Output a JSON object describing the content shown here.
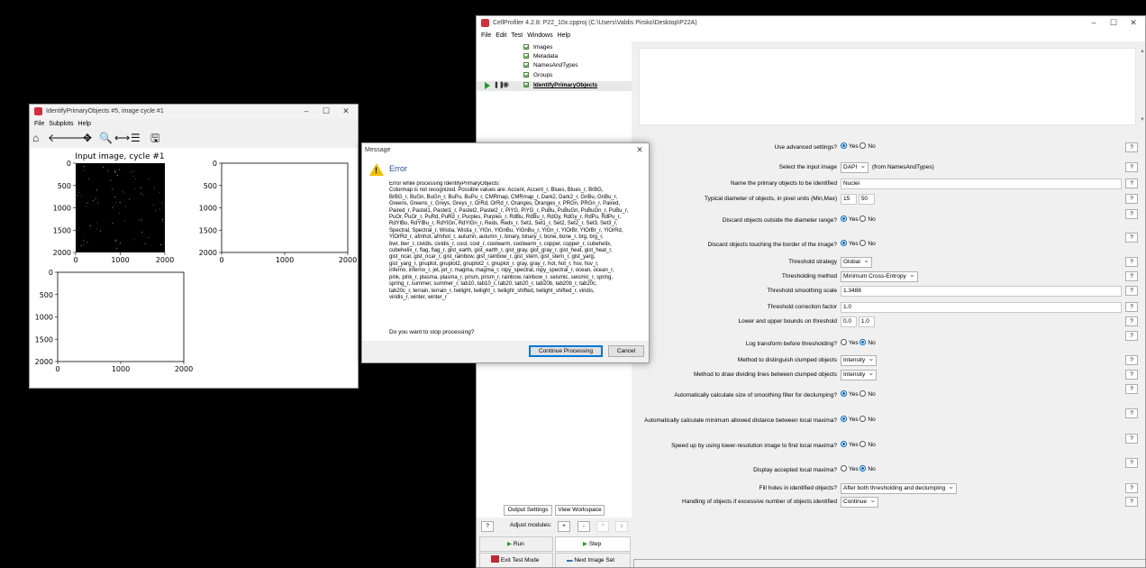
{
  "plot_window": {
    "title": "IdentifyPrimaryObjects #5, image cycle #1",
    "menus": [
      "File",
      "Subplots",
      "Help"
    ],
    "plot_title": "Input image, cycle #1",
    "axis_ticks_y": [
      "0",
      "500",
      "1000",
      "1500",
      "2000"
    ],
    "axis_ticks_x": [
      "0",
      "1000",
      "2000"
    ]
  },
  "message_dialog": {
    "title": "Message",
    "heading": "Error",
    "body_lines": [
      "Error while processing IdentifyPrimaryObjects:",
      "Colormap  is not recognized. Possible values are: Accent, Accent_r, Blues, Blues_r, BrBG,",
      "BrBG_r, BuGn, BuGn_r, BuPu, BuPu_r, CMRmap, CMRmap_r, Dark2, Dark2_r, GnBu, GnBu_r,",
      "Greens, Greens_r, Greys, Greys_r, OrRd, OrRd_r, Oranges, Oranges_r, PRGn, PRGn_r, Paired,",
      "Paired_r, Pastel1, Pastel1_r, Pastel2, Pastel2_r, PiYG, PiYG_r, PuBu, PuBuGn, PuBuGn_r, PuBu_r,",
      "PuOr, PuOr_r, PuRd, PuRd_r, Purples, Purples_r, RdBu, RdBu_r, RdGy, RdGy_r, RdPu, RdPu_r,",
      "RdYlBu, RdYlBu_r, RdYlGn, RdYlGn_r, Reds, Reds_r, Set1, Set1_r, Set2, Set2_r, Set3, Set3_r,",
      "Spectral, Spectral_r, Wistia, Wistia_r, YlGn, YlGnBu, YlGnBu_r, YlGn_r, YlOrBr, YlOrBr_r, YlOrRd,",
      "YlOrRd_r, afmhot, afmhot_r, autumn, autumn_r, binary, binary_r, bone, bone_r, brg, brg_r,",
      "bwr, bwr_r, cividis, cividis_r, cool, cool_r, coolwarm, coolwarm_r, copper, copper_r, cubehelix,",
      "cubehelix_r, flag, flag_r, gist_earth, gist_earth_r, gist_gray, gist_gray_r, gist_heat, gist_heat_r,",
      "gist_ncar, gist_ncar_r, gist_rainbow, gist_rainbow_r, gist_stern, gist_stern_r, gist_yarg,",
      "gist_yarg_r, gnuplot, gnuplot2, gnuplot2_r, gnuplot_r, gray, gray_r, hot, hot_r, hsv, hsv_r,",
      "inferno, inferno_r, jet, jet_r, magma, magma_r, nipy_spectral, nipy_spectral_r, ocean, ocean_r,",
      "pink, pink_r, plasma, plasma_r, prism, prism_r, rainbow, rainbow_r, seismic, seismic_r, spring,",
      "spring_r, summer, summer_r, tab10, tab10_r, tab20, tab20_r, tab20b, tab20b_r, tab20c,",
      "tab20c_r, terrain, terrain_r, twilight, twilight_r, twilight_shifted, twilight_shifted_r, viridis,",
      "viridis_r, winter, winter_r"
    ],
    "question": "Do you want to stop processing?",
    "continue_label": "Continue Processing",
    "cancel_label": "Cancel"
  },
  "cp_window": {
    "title": "CellProfiler 4.2.8: P22_10x.cpproj (C:\\Users\\Valdis Pirsko\\Desktop\\P22A)",
    "menus": [
      "File",
      "Edit",
      "Test",
      "Windows",
      "Help"
    ],
    "modules": [
      "Images",
      "Metadata",
      "NamesAndTypes",
      "Groups",
      "IdentifyPrimaryObjects"
    ],
    "output_settings_label": "Output Settings",
    "view_workspace_label": "View Workspace",
    "adjust_modules_label": "Adjust modules:",
    "help_label": "?",
    "add_label": "+",
    "remove_label": "-",
    "up_label": "^",
    "down_label": "v",
    "run_label": "Run",
    "step_label": "Step",
    "exit_test_label": "Exit Test Mode",
    "next_image_label": "Next Image Set",
    "yes_label": "Yes",
    "no_label": "No",
    "settings": {
      "advanced": {
        "label": "Use advanced settings?",
        "value": "Yes"
      },
      "input_image": {
        "label": "Select the input image",
        "value": "DAPI",
        "note": "(from NamesAndTypes)"
      },
      "objects_name": {
        "label": "Name the primary objects to be identified",
        "value": "Nuclei"
      },
      "diameter": {
        "label": "Typical diameter of objects, in pixel units (Min,Max)",
        "min": "15",
        "max": "50"
      },
      "discard_outside": {
        "label": "Discard objects outside the diameter range?",
        "value": "Yes"
      },
      "discard_border": {
        "label": "Discard objects touching the border of the image?",
        "value": "Yes"
      },
      "threshold_strategy": {
        "label": "Threshold strategy",
        "value": "Global"
      },
      "threshold_method": {
        "label": "Thresholding method",
        "value": "Minimum Cross-Entropy"
      },
      "smoothing_scale": {
        "label": "Threshold smoothing scale",
        "value": "1.3488"
      },
      "correction_factor": {
        "label": "Threshold correction factor",
        "value": "1.0"
      },
      "bounds": {
        "label": "Lower and upper bounds on threshold",
        "lower": "0.0",
        "upper": "1.0"
      },
      "log_transform": {
        "label": "Log transform before thresholding?",
        "value": "No"
      },
      "distinguish_method": {
        "label": "Method to distinguish clumped objects",
        "value": "Intensity"
      },
      "dividing_lines": {
        "label": "Method to draw dividing lines between clumped objects",
        "value": "Intensity"
      },
      "auto_smoothing": {
        "label": "Automatically calculate size of smoothing filter for declumping?",
        "value": "Yes"
      },
      "auto_min_distance": {
        "label": "Automatically calculate minimum allowed distance between local maxima?",
        "value": "Yes"
      },
      "low_res": {
        "label": "Speed up by using lower-resolution image to find local maxima?",
        "value": "Yes"
      },
      "display_maxima": {
        "label": "Display accepted local maxima?",
        "value": "No"
      },
      "fill_holes": {
        "label": "Fill holes in identified objects?",
        "value": "After both thresholding and declumping"
      },
      "excessive": {
        "label": "Handling of objects if excessive number of objects identified",
        "value": "Continue"
      }
    }
  }
}
